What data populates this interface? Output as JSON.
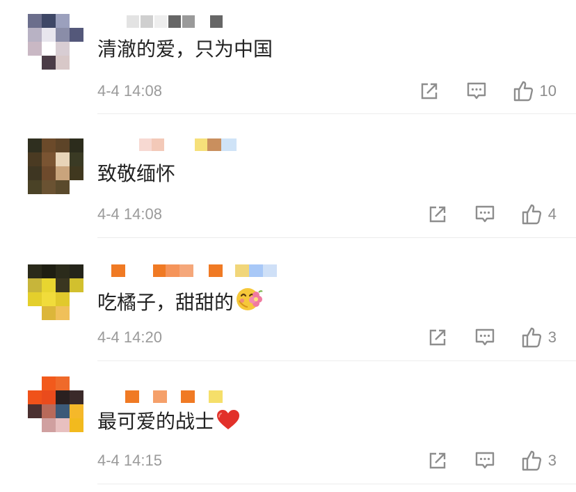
{
  "comments": [
    {
      "text": "清澈的爱，只为中国",
      "time": "4-4 14:08",
      "likes": "10",
      "emoji": ""
    },
    {
      "text": "致敬缅怀",
      "time": "4-4 14:08",
      "likes": "4",
      "emoji": ""
    },
    {
      "text": "吃橘子，甜甜的",
      "time": "4-4 14:20",
      "likes": "3",
      "emoji": "happy-face-flower-emoji"
    },
    {
      "text": "最可爱的战士",
      "time": "4-4 14:15",
      "likes": "3",
      "emoji": "red-heart-emoji"
    }
  ],
  "icons": {
    "share": "share-icon",
    "reply": "comment-icon",
    "like": "thumbs-up-icon"
  },
  "colors": {
    "text": "#222222",
    "meta": "#9a9a9a",
    "icon": "#8d8d8d"
  }
}
